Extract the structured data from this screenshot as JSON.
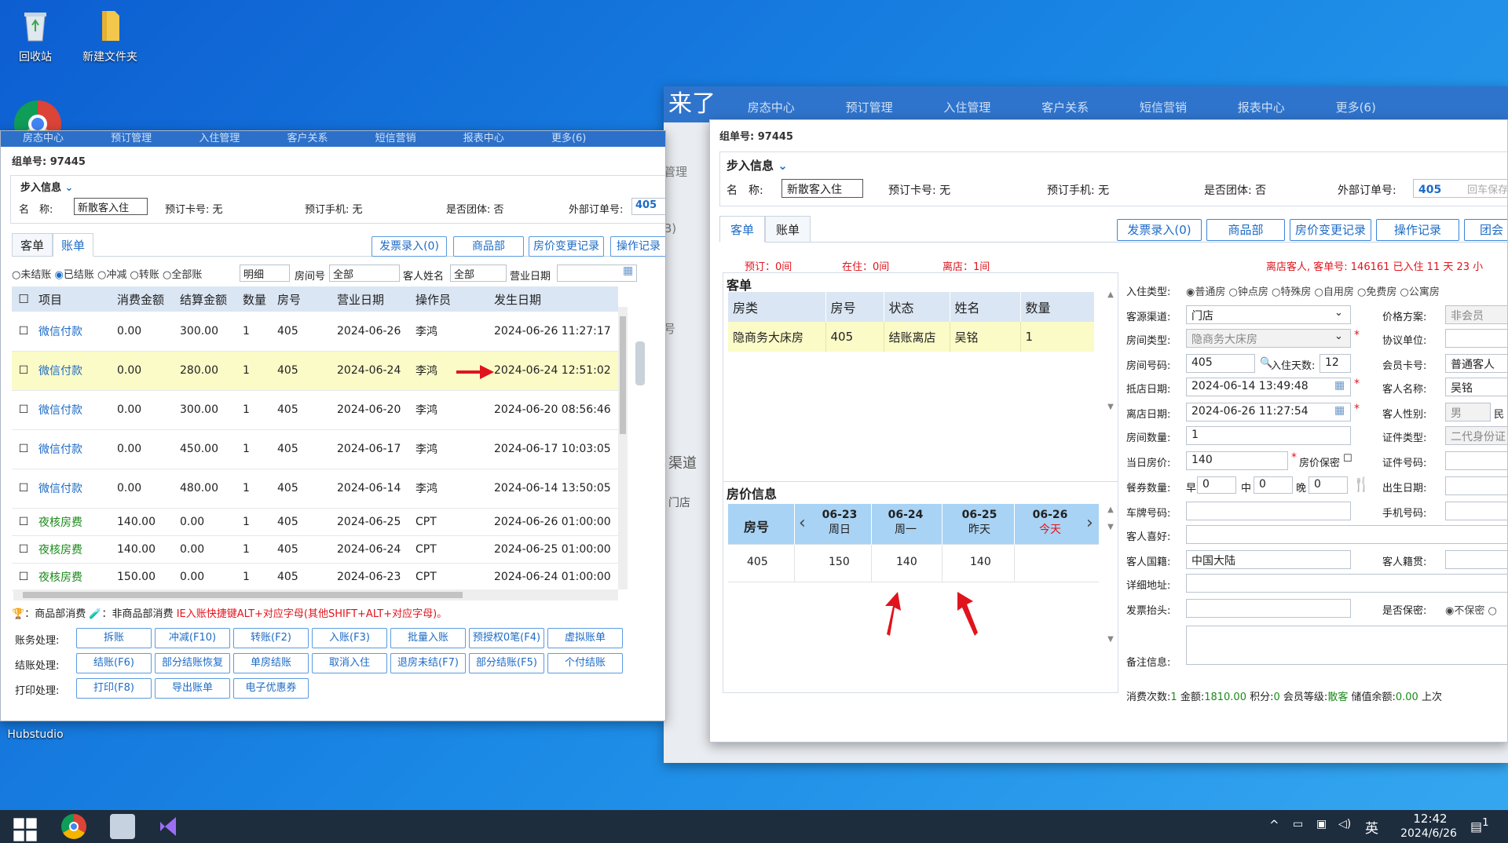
{
  "desktop": {
    "icons": [
      {
        "label": "回收站",
        "glyph": "recycle-bin"
      },
      {
        "label": "新建文件夹",
        "glyph": "folder"
      },
      {
        "label": "Hubstudio",
        "glyph": "hubstudio"
      }
    ]
  },
  "left": {
    "appbar": [
      "房态中心",
      "预订管理",
      "入住管理",
      "客户关系",
      "短信营销",
      "报表中心",
      "更多(6)"
    ],
    "order_label": "组单号: 97445",
    "section_title": "步入信息",
    "name_label": "名　称:",
    "name_value": "新散客入住",
    "card_label": "预订卡号: 无",
    "phone_label": "预订手机: 无",
    "group_label": "是否团体: 否",
    "ext_label": "外部订单号:",
    "ext_value": "405",
    "tabs": [
      "客单",
      "账单"
    ],
    "toolbar": [
      "发票录入(0)",
      "商品部",
      "房价变更记录",
      "操作记录"
    ],
    "filters": {
      "radios": [
        "未结账",
        "已结账",
        "冲减",
        "转账",
        "全部账"
      ],
      "selected": "已结账",
      "detail": "明细",
      "room_label": "房间号",
      "room_value": "全部",
      "guest_label": "客人姓名",
      "guest_value": "全部",
      "date_label": "营业日期"
    },
    "columns": [
      "项目",
      "消费金额",
      "结算金额",
      "数量",
      "房号",
      "营业日期",
      "操作员",
      "发生日期"
    ],
    "rows": [
      [
        "微信付款",
        "0.00",
        "300.00",
        "1",
        "405",
        "2024-06-26",
        "李鸿",
        "2024-06-26 11:27:17"
      ],
      [
        "微信付款",
        "0.00",
        "280.00",
        "1",
        "405",
        "2024-06-24",
        "李鸿",
        "2024-06-24 12:51:02"
      ],
      [
        "微信付款",
        "0.00",
        "300.00",
        "1",
        "405",
        "2024-06-20",
        "李鸿",
        "2024-06-20 08:56:46"
      ],
      [
        "微信付款",
        "0.00",
        "450.00",
        "1",
        "405",
        "2024-06-17",
        "李鸿",
        "2024-06-17 10:03:05"
      ],
      [
        "微信付款",
        "0.00",
        "480.00",
        "1",
        "405",
        "2024-06-14",
        "李鸿",
        "2024-06-14 13:50:05"
      ],
      [
        "夜核房费",
        "140.00",
        "0.00",
        "1",
        "405",
        "2024-06-25",
        "CPT",
        "2024-06-26 01:00:00"
      ],
      [
        "夜核房费",
        "140.00",
        "0.00",
        "1",
        "405",
        "2024-06-24",
        "CPT",
        "2024-06-25 01:00:00"
      ],
      [
        "夜核房费",
        "150.00",
        "0.00",
        "1",
        "405",
        "2024-06-23",
        "CPT",
        "2024-06-24 01:00:00"
      ]
    ],
    "legend_a": "：商品部消费",
    "legend_b": "：非商品部消费",
    "legend_hint": "IE入账快捷键ALT+对应字母(其他SHIFT+ALT+对应字母)。",
    "row_labels": [
      "账务处理:",
      "结账处理:",
      "打印处理:"
    ],
    "acct_buttons": [
      "拆账",
      "冲减(F10)",
      "转账(F2)",
      "入账(F3)",
      "批量入账",
      "预授权0笔(F4)",
      "虚拟账单"
    ],
    "checkout_buttons": [
      "结账(F6)",
      "部分结账恢复",
      "单房结账",
      "取消入住",
      "退房未结(F7)",
      "部分结账(F5)",
      "个付结账"
    ],
    "print_buttons": [
      "打印(F8)",
      "导出账单",
      "电子优惠券"
    ]
  },
  "right": {
    "appbar": [
      "来了",
      "房态中心",
      "预订管理",
      "入住管理",
      "客户关系",
      "短信营销",
      "报表中心",
      "更多(6)"
    ],
    "bg_texts": [
      "管理",
      "B)",
      "号",
      "渠道",
      "门店"
    ],
    "order_label": "组单号: 97445",
    "section_title": "步入信息",
    "name_label": "名　称:",
    "name_value": "新散客入住",
    "card_label": "预订卡号: 无",
    "phone_label": "预订手机: 无",
    "group_label": "是否团体: 否",
    "ext_label": "外部订单号:",
    "ext_value": "405",
    "ext_hint": "回车保存",
    "tabs": [
      "客单",
      "账单"
    ],
    "toolbar": [
      "发票录入(0)",
      "商品部",
      "房价变更记录",
      "操作记录",
      "团会"
    ],
    "stats": [
      "预订：0间",
      "在住：0间",
      "离店：1间"
    ],
    "leave_info": "离店客人, 客单号: 146161 已入住 11 天 23 小",
    "guest_title": "客单",
    "guest_cols": [
      "房类",
      "房号",
      "状态",
      "姓名",
      "数量"
    ],
    "guest_row": [
      "隐商务大床房",
      "405",
      "结账离店",
      "吴铭",
      "1"
    ],
    "price_title": "房价信息",
    "price_header": {
      "room": "房号",
      "days": [
        {
          "date": "06-23",
          "label": "周日"
        },
        {
          "date": "06-24",
          "label": "周一"
        },
        {
          "date": "06-25",
          "label": "昨天"
        },
        {
          "date": "06-26",
          "label": "今天"
        }
      ]
    },
    "price_row": {
      "room": "405",
      "values": [
        "150",
        "140",
        "140",
        ""
      ]
    },
    "form": {
      "checkin_type_label": "入住类型:",
      "checkin_types": [
        "普通房",
        "钟点房",
        "特殊房",
        "自用房",
        "免费房",
        "公寓房"
      ],
      "source_label": "客源渠道:",
      "source_value": "门店",
      "roomtype_label": "房间类型:",
      "roomtype_value": "隐商务大床房",
      "roomno_label": "房间号码:",
      "roomno_value": "405",
      "days_label": "入住天数:",
      "days_value": "12",
      "arrive_label": "抵店日期:",
      "arrive_value": "2024-06-14 13:49:48",
      "leave_label": "离店日期:",
      "leave_value": "2024-06-26 11:27:54",
      "count_label": "房间数量:",
      "count_value": "1",
      "price_label": "当日房价:",
      "price_value": "140",
      "secret_price": "房价保密",
      "meal_label": "餐券数量:",
      "meal_b": "早",
      "meal_l": "中",
      "meal_d": "晚",
      "meal_values": [
        "0",
        "0",
        "0"
      ],
      "plate_label": "车牌号码:",
      "pref_label": "客人喜好:",
      "nation_label": "客人国籍:",
      "nation_value": "中国大陆",
      "addr_label": "详细地址:",
      "invoice_label": "发票抬头:",
      "note_label": "备注信息:",
      "plan_label": "价格方案:",
      "plan_value": "非会员",
      "unit_label": "协议单位:",
      "member_label": "会员卡号:",
      "member_value": "普通客人",
      "gname_label": "客人名称:",
      "gname_value": "吴铭",
      "gender_label": "客人性别:",
      "gender_value": "男",
      "ethnic": "民",
      "idtype_label": "证件类型:",
      "idtype_value": "二代身份证",
      "idno_label": "证件号码:",
      "birth_label": "出生日期:",
      "mobile_label": "手机号码:",
      "origin_label": "客人籍贯:",
      "secret_label": "是否保密:",
      "secret_no": "不保密"
    },
    "footer": {
      "count_label": "消费次数:",
      "count": "1",
      "amount_label": "金额:",
      "amount": "1810.00",
      "points_label": "积分:",
      "points": "0",
      "level_label": "会员等级:",
      "level": "散客",
      "balance_label": "储值余额:",
      "balance": "0.00",
      "more": "上次"
    }
  },
  "taskbar": {
    "time": "12:42",
    "date": "2024/6/26",
    "ime": "英",
    "notif": "1"
  }
}
